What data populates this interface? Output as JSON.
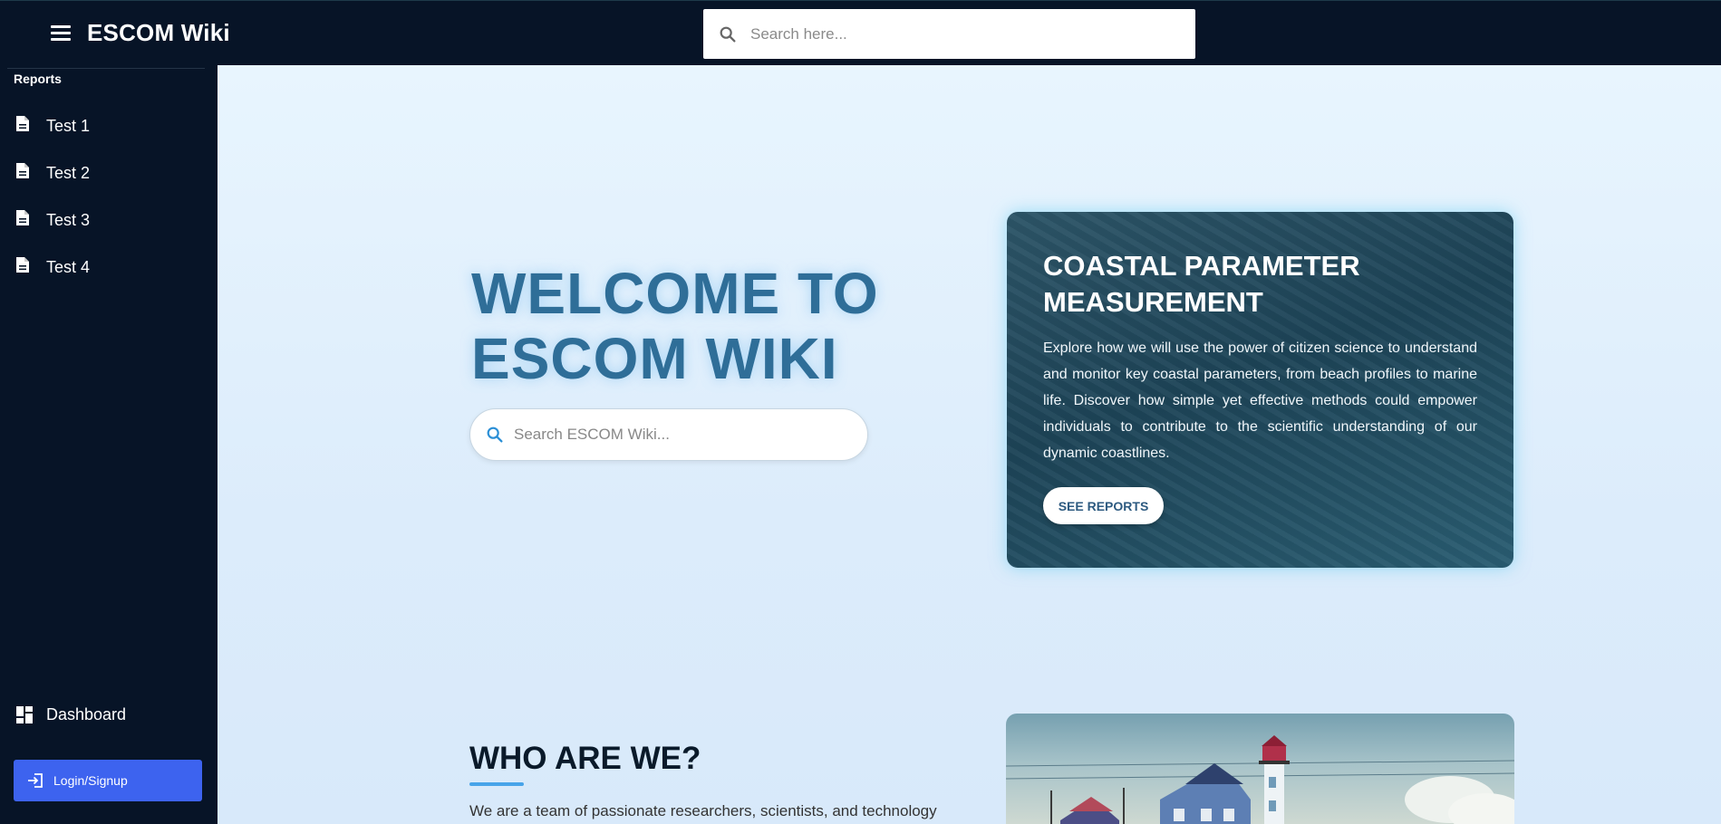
{
  "header": {
    "app_title": "ESCOM Wiki",
    "search_placeholder": "Search here..."
  },
  "sidebar": {
    "section_label": "Reports",
    "items": [
      {
        "label": "Test 1",
        "icon": "document-icon"
      },
      {
        "label": "Test 2",
        "icon": "document-icon"
      },
      {
        "label": "Test 3",
        "icon": "document-icon"
      },
      {
        "label": "Test 4",
        "icon": "document-icon"
      }
    ],
    "dashboard_label": "Dashboard",
    "login_label": "Login/Signup"
  },
  "hero": {
    "title_line1": "WELCOME TO",
    "title_line2": "ESCOM WIKI",
    "search_placeholder": "Search ESCOM Wiki..."
  },
  "coastal_card": {
    "title_line1": "COASTAL PARAMETER",
    "title_line2": "MEASUREMENT",
    "description": "Explore how we will use the power of citizen science to understand and monitor key coastal parameters, from beach profiles to marine life. Discover how simple yet effective methods could empower individuals to contribute to the scientific understanding of our dynamic coastlines.",
    "button_label": "SEE REPORTS"
  },
  "who": {
    "title": "WHO ARE WE?",
    "text": "We are a team of passionate researchers, scientists, and technology"
  },
  "colors": {
    "topbar": "#071427",
    "accent_button": "#3d63ef",
    "welcome_text": "#2f6e98",
    "underline": "#47a4e9"
  }
}
